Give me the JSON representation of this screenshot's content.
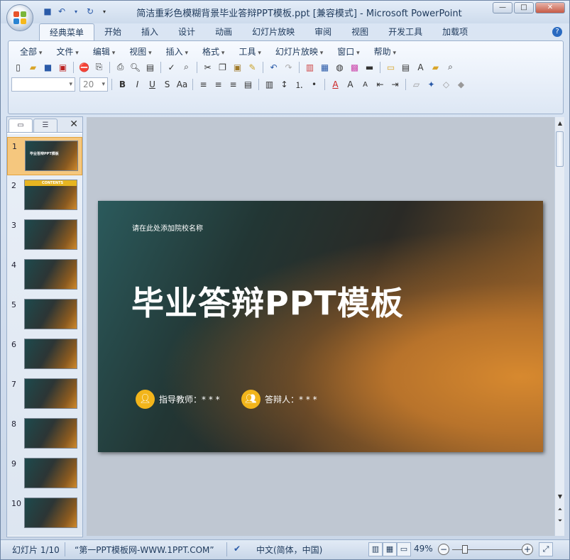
{
  "window": {
    "title": "简洁重彩色模糊背景毕业答辩PPT模板.ppt [兼容模式] - Microsoft PowerPoint"
  },
  "ribbon_tabs": [
    {
      "label": "经典菜单",
      "active": true
    },
    {
      "label": "开始"
    },
    {
      "label": "插入"
    },
    {
      "label": "设计"
    },
    {
      "label": "动画"
    },
    {
      "label": "幻灯片放映"
    },
    {
      "label": "审阅"
    },
    {
      "label": "视图"
    },
    {
      "label": "开发工具"
    },
    {
      "label": "加载项"
    }
  ],
  "menus": [
    "全部",
    "文件",
    "编辑",
    "视图",
    "插入",
    "格式",
    "工具",
    "幻灯片放映",
    "窗口",
    "帮助"
  ],
  "font": {
    "family_value": "",
    "size_value": "20"
  },
  "thumbnails": [
    {
      "num": "1",
      "caption": "毕业答辩PPT模板",
      "selected": true
    },
    {
      "num": "2",
      "caption": "CONTENTS"
    },
    {
      "num": "3",
      "caption": ""
    },
    {
      "num": "4",
      "caption": ""
    },
    {
      "num": "5",
      "caption": ""
    },
    {
      "num": "6",
      "caption": ""
    },
    {
      "num": "7",
      "caption": ""
    },
    {
      "num": "8",
      "caption": ""
    },
    {
      "num": "9",
      "caption": ""
    },
    {
      "num": "10",
      "caption": ""
    }
  ],
  "slide": {
    "school": "请在此处添加院校名称",
    "title": "毕业答辩PPT模板",
    "advisor": "指导教师：* * *",
    "presenter": "答辩人：* * *"
  },
  "status": {
    "slide_count": "幻灯片 1/10",
    "theme": "“第一PPT模板网-WWW.1PPT.COM”",
    "language": "中文(简体，中国)",
    "zoom": "49%"
  },
  "colors": {
    "accent": "#f2b51b",
    "selected_thumb": "#f5c77e"
  }
}
